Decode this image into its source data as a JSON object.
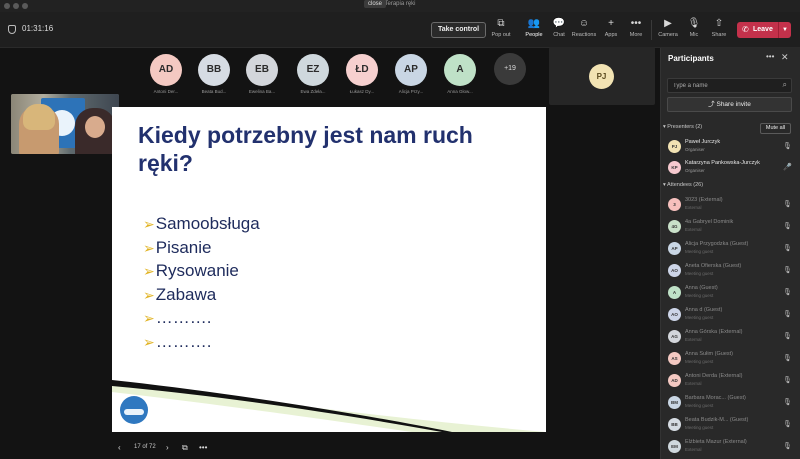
{
  "window": {
    "title": "Terapia ręki",
    "close_tooltip": "close"
  },
  "topbar": {
    "timer": "01:31:16",
    "take_control": "Take control",
    "buttons": [
      {
        "icon": "pop-out-icon",
        "glyph": "⧉",
        "label": "Pop out"
      },
      {
        "icon": "people-icon",
        "glyph": "👥",
        "label": "People"
      },
      {
        "icon": "chat-icon",
        "glyph": "💬",
        "label": "Chat"
      },
      {
        "icon": "reactions-icon",
        "glyph": "☺",
        "label": "Reactions"
      },
      {
        "icon": "apps-icon",
        "glyph": "+",
        "label": "Apps"
      },
      {
        "icon": "more-icon",
        "glyph": "•••",
        "label": "More"
      },
      {
        "icon": "camera-icon",
        "glyph": "▶",
        "label": "Camera"
      },
      {
        "icon": "mic-off-icon",
        "glyph": "🎙",
        "label": "Mic"
      },
      {
        "icon": "share-icon",
        "glyph": "⇧",
        "label": "Share"
      }
    ],
    "leave": "Leave"
  },
  "stage": {
    "avatars": [
      {
        "initials": "AD",
        "name": "Antoni Der...",
        "color": "#f4c9c2"
      },
      {
        "initials": "BB",
        "name": "Beata Bud...",
        "color": "#d6dce3"
      },
      {
        "initials": "EB",
        "name": "Ewelina Ba...",
        "color": "#d3d6db"
      },
      {
        "initials": "EZ",
        "name": "Ewa Zdeła...",
        "color": "#cfd8dd"
      },
      {
        "initials": "ŁD",
        "name": "Łukasz Dy...",
        "color": "#f6d0cf"
      },
      {
        "initials": "AP",
        "name": "Alicja Przy...",
        "color": "#c9d6e4"
      },
      {
        "initials": "A",
        "name": "Anna Głow...",
        "color": "#bfe1c7"
      }
    ],
    "more_count": "+19",
    "speaker_tile_initials": "PJ"
  },
  "slide": {
    "title": "Kiedy potrzebny jest nam ruch ręki?",
    "bullets": [
      "Samoobsługa",
      "Pisanie",
      "Rysowanie",
      "Zabawa",
      "……….",
      "………."
    ],
    "bullet_marker": "➢",
    "page": "17 of 72"
  },
  "panel": {
    "title": "Participants",
    "search_placeholder": "Type a name",
    "share_invite": "Share invite",
    "presenters_header": "Presenters (2)",
    "mute_all": "Mute all",
    "attendees_header": "Attendees (26)",
    "presenters": [
      {
        "initials": "PJ",
        "name": "Paweł Jurczyk",
        "role": "Organiser",
        "color": "#f2e3b3"
      },
      {
        "initials": "KP",
        "name": "Katarzyna Pankowska-Jurczyk",
        "role": "Organiser",
        "color": "#f6c9cf"
      }
    ],
    "attendees": [
      {
        "initials": "3",
        "name": "3023 (External)",
        "role": "External",
        "color": "#f6c0bd"
      },
      {
        "initials": "4G",
        "name": "4a Gabryel Dominik",
        "role": "External",
        "color": "#c9e1c9"
      },
      {
        "initials": "AP",
        "name": "Alicja Przygodzka (Guest)",
        "role": "Meeting guest",
        "color": "#c9d6e4"
      },
      {
        "initials": "AO",
        "name": "Aneta Ofierska (Guest)",
        "role": "Meeting guest",
        "color": "#cdd5e8"
      },
      {
        "initials": "A",
        "name": "Anna (Guest)",
        "role": "Meeting guest",
        "color": "#bfe1c7"
      },
      {
        "initials": "AO",
        "name": "Anna d (Guest)",
        "role": "Meeting guest",
        "color": "#cdd5e8"
      },
      {
        "initials": "AG",
        "name": "Anna Górska (External)",
        "role": "External",
        "color": "#d3d6db"
      },
      {
        "initials": "AS",
        "name": "Anna Sułim (Guest)",
        "role": "Meeting guest",
        "color": "#f4c9c2"
      },
      {
        "initials": "AD",
        "name": "Antoni Derda (External)",
        "role": "External",
        "color": "#f4c9c2"
      },
      {
        "initials": "BM",
        "name": "Barbara Morac... (Guest)",
        "role": "Meeting guest",
        "color": "#c9d6e4"
      },
      {
        "initials": "BB",
        "name": "Beata Budzik-M... (Guest)",
        "role": "Meeting guest",
        "color": "#d6dce3"
      },
      {
        "initials": "EM",
        "name": "Elżbieta Mazur (External)",
        "role": "External",
        "color": "#cfd8dd"
      }
    ]
  }
}
